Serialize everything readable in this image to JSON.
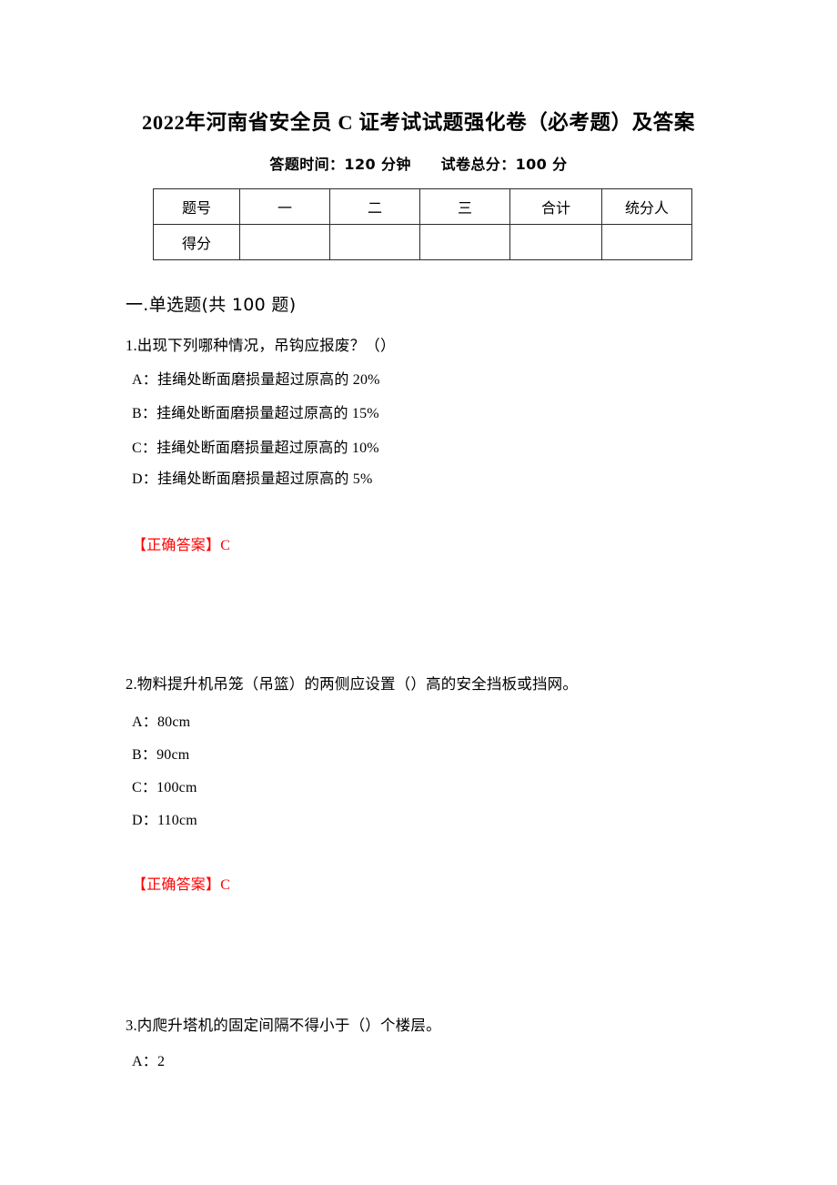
{
  "document": {
    "title": "2022年河南省安全员 C 证考试试题强化卷（必考题）及答案",
    "subtitle": "答题时间：120 分钟　　试卷总分：100 分"
  },
  "score_table": {
    "header": [
      "题号",
      "一",
      "二",
      "三",
      "合计",
      "统分人"
    ],
    "row": [
      "得分",
      "",
      "",
      "",
      "",
      ""
    ]
  },
  "section": {
    "heading": "一.单选题(共 100 题)"
  },
  "answer_color": "#fe0000",
  "questions": [
    {
      "stem": "1.出现下列哪种情况，吊钩应报废？（）",
      "options": [
        "A：挂绳处断面磨损量超过原高的 20%",
        "B：挂绳处断面磨损量超过原高的 15%",
        "C：挂绳处断面磨损量超过原高的 10%",
        "D：挂绳处断面磨损量超过原高的 5%"
      ],
      "answer": "【正确答案】C"
    },
    {
      "stem": "2.物料提升机吊笼（吊篮）的两侧应设置（）高的安全挡板或挡网。",
      "options": [
        "A：80cm",
        "B：90cm",
        "C：100cm",
        "D：110cm"
      ],
      "answer": "【正确答案】C"
    },
    {
      "stem": "3.内爬升塔机的固定间隔不得小于（）个楼层。",
      "options": [
        "A：2"
      ],
      "answer": ""
    }
  ]
}
